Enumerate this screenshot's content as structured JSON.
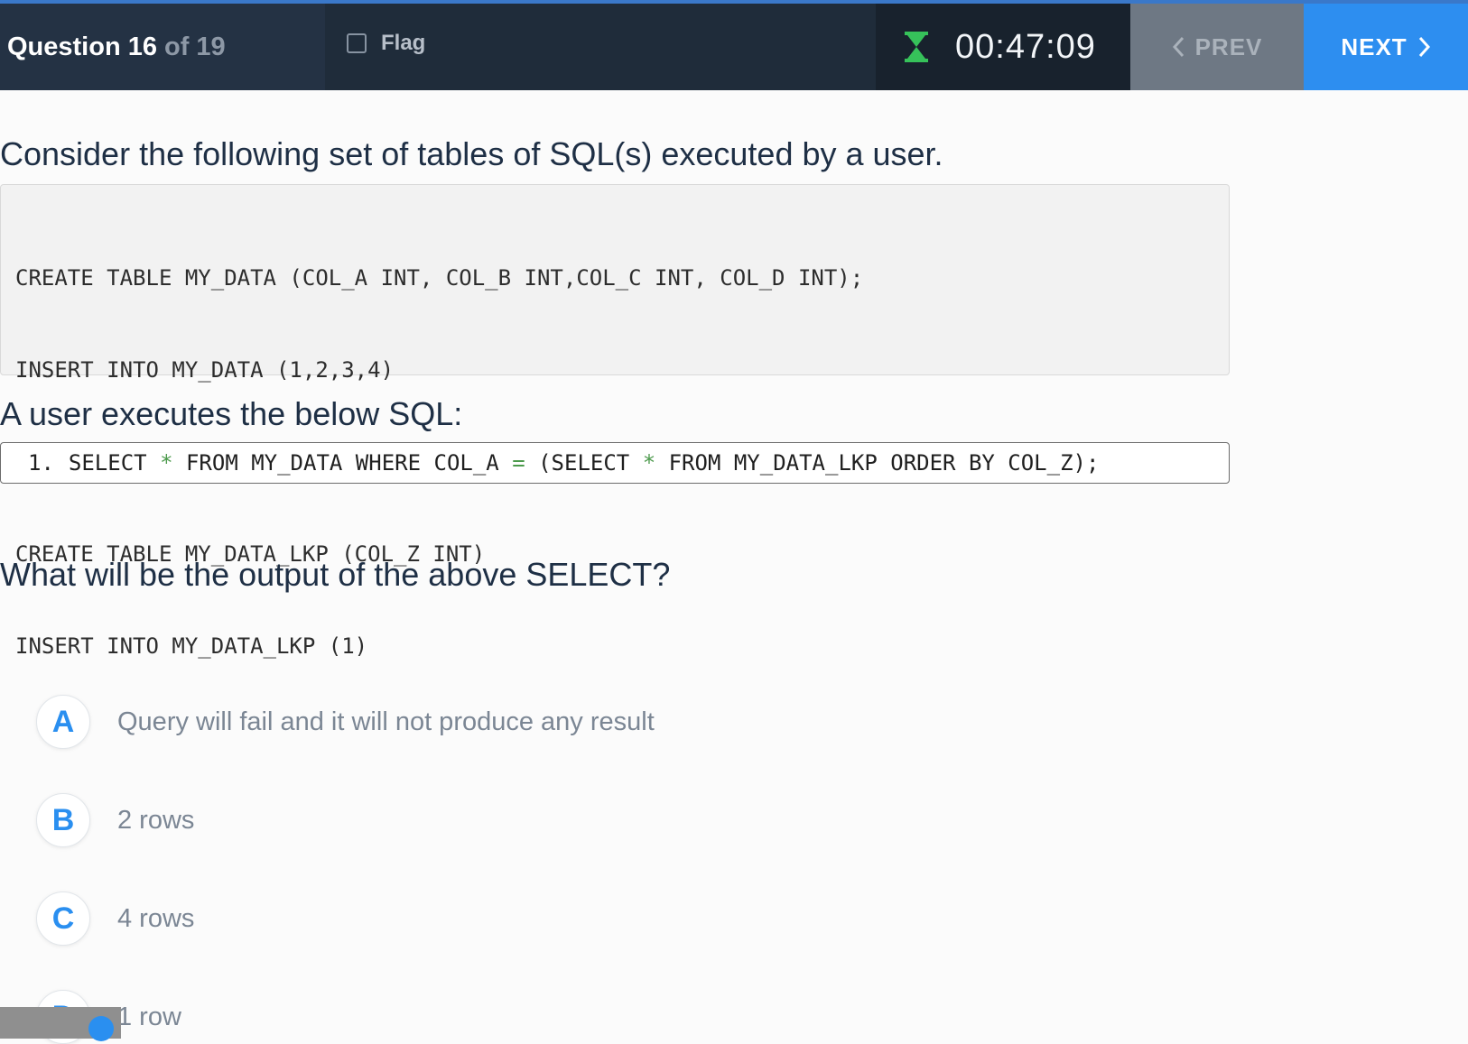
{
  "header": {
    "question_label": "Question 16",
    "question_of": "of 19",
    "flag_label": "Flag",
    "timer": "00:47:09",
    "prev_label": "PREV",
    "next_label": "NEXT"
  },
  "question": {
    "intro": "Consider the following set of tables of SQL(s) executed by a user.",
    "code_lines": [
      "CREATE TABLE MY_DATA (COL_A INT, COL_B INT,COL_C INT, COL_D INT);",
      "INSERT INTO MY_DATA (1,2,3,4)",
      "CREATE TABLE MY_DATA_LKP (COL_Z INT)",
      "INSERT INTO MY_DATA_LKP (1)"
    ],
    "execute_prompt": "A user executes the below SQL:",
    "sql_number": "1.",
    "sql_parts": {
      "p1": "SELECT ",
      "star1": "*",
      "p2": " FROM MY_DATA WHERE COL_A ",
      "eq": "=",
      "p3": " (SELECT ",
      "star2": "*",
      "p4": " FROM MY_DATA_LKP ORDER BY COL_Z);"
    },
    "ask": "What will be the output of the above SELECT?"
  },
  "options": [
    {
      "letter": "A",
      "text": "Query will fail and it will not produce any result"
    },
    {
      "letter": "B",
      "text": "2 rows"
    },
    {
      "letter": "C",
      "text": "4 rows"
    },
    {
      "letter": "D",
      "text": "1 row"
    }
  ],
  "colors": {
    "accent": "#2d8ef0",
    "header_bg": "#1f2c3a",
    "timer_icon": "#36c25a"
  },
  "icons": {
    "timer": "hourglass-icon",
    "prev": "chevron-left-icon",
    "next": "chevron-right-icon",
    "flag": "checkbox-icon"
  }
}
